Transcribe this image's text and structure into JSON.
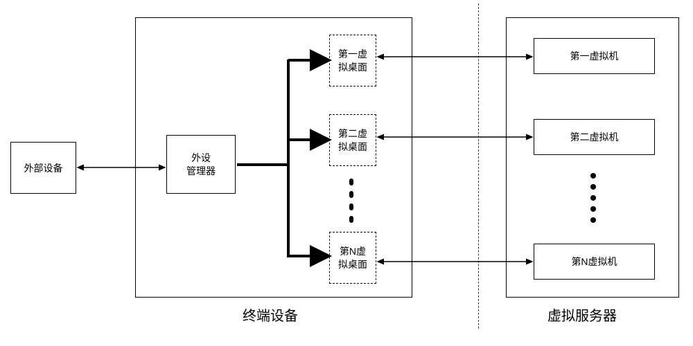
{
  "external_device": {
    "label": "外部设备"
  },
  "terminal": {
    "label": "终端设备",
    "peripheral_manager": "外设\n管理器",
    "desktops": {
      "first": "第一虚\n拟桌面",
      "second": "第二虚\n拟桌面",
      "nth": "第N虚\n拟桌面"
    }
  },
  "server": {
    "label": "虚拟服务器",
    "vms": {
      "first": "第一虚拟机",
      "second": "第二虚拟机",
      "nth": "第N虚拟机"
    }
  }
}
